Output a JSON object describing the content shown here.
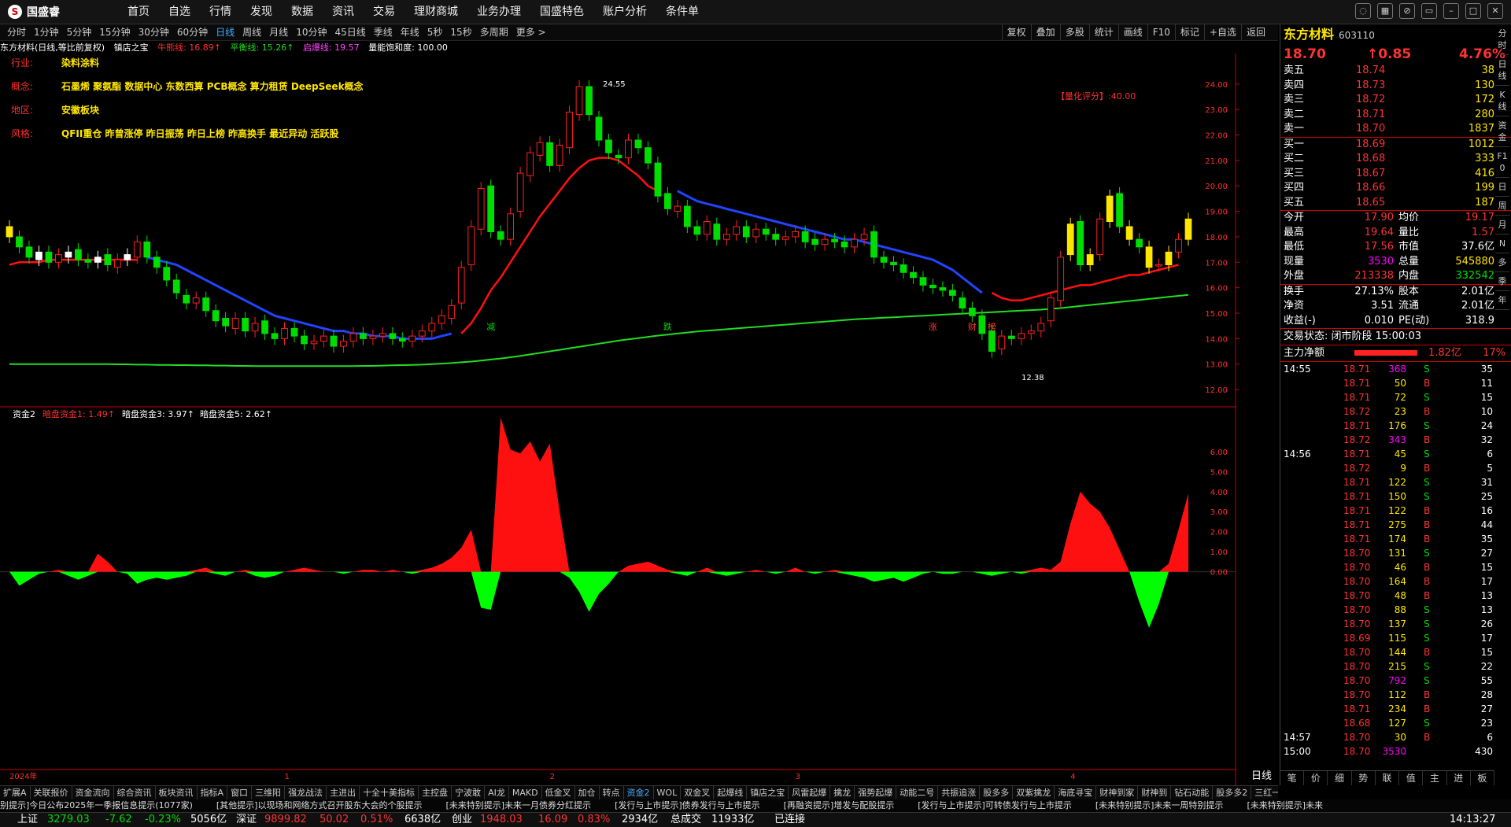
{
  "app": {
    "logo": "国盛睿"
  },
  "menu": [
    "首页",
    "自选",
    "行情",
    "发现",
    "数据",
    "资讯",
    "交易",
    "理财商城",
    "业务办理",
    "国盛特色",
    "账户分析",
    "条件单"
  ],
  "window_controls": [
    "chat-icon",
    "grid-icon",
    "hide-icon",
    "restore-icon",
    "minimize-icon",
    "maximize-icon",
    "close-icon"
  ],
  "periods": [
    "分时",
    "1分钟",
    "5分钟",
    "15分钟",
    "30分钟",
    "60分钟",
    "日线",
    "周线",
    "月线",
    "10分钟",
    "45日线",
    "季线",
    "年线",
    "5秒",
    "15秒",
    "多周期",
    "更多 >"
  ],
  "active_period": "日线",
  "tools": [
    "复权",
    "叠加",
    "多股",
    "统计",
    "画线",
    "F10",
    "标记",
    "+自选",
    "返回"
  ],
  "info": {
    "title": "东方材料(日线,等比前复权)",
    "indicator": "镇店之宝",
    "l1": "牛熊线: 16.89↑",
    "l2": "平衡线: 15.26↑",
    "l3": "启爆线: 19.57",
    "l4": "量能饱和度: 100.00"
  },
  "annotations": {
    "industry_label": "行业:",
    "industry": "染料涂料",
    "concept_label": "概念:",
    "concept": "石墨烯 聚氨酯 数据中心 东数西算 PCB概念 算力租赁 DeepSeek概念",
    "region_label": "地区:",
    "region": "安徽板块",
    "style_label": "风格:",
    "style": "QFII重仓 昨曾涨停 昨日振荡 昨日上榜 昨高换手 最近异动 活跃股",
    "rating": "【量化评分】:40.00",
    "high_label": "24.55",
    "low_label": "12.38"
  },
  "chart_data": {
    "type": "candlestick",
    "price_axis": [
      "24.00",
      "23.00",
      "22.00",
      "21.00",
      "20.00",
      "19.00",
      "18.00",
      "17.00",
      "16.00",
      "15.00",
      "14.00",
      "13.00",
      "12.00"
    ],
    "price_range": [
      11.6,
      25.2
    ],
    "x_labels": [
      "2024年",
      "1",
      "2",
      "3",
      "4"
    ],
    "event_markers": [
      "减",
      "跌",
      "涨",
      "财",
      "榜"
    ],
    "sub_title": "资金2",
    "sub_l1": "暗盘资金1: 1.49↑",
    "sub_l2": "暗盘资金3: 3.97↑",
    "sub_l3": "暗盘资金5: 2.62↑",
    "sub_axis": [
      "6.00",
      "5.00",
      "4.00",
      "3.00",
      "2.00",
      "1.00",
      "0.00"
    ],
    "sub_range": [
      -3.0,
      7.8
    ],
    "closes": [
      18.0,
      17.6,
      17.2,
      17.4,
      17.0,
      17.3,
      17.4,
      17.1,
      17.0,
      17.2,
      16.9,
      17.1,
      17.3,
      17.8,
      17.2,
      16.8,
      16.3,
      15.8,
      15.4,
      15.6,
      15.1,
      14.7,
      14.5,
      14.8,
      14.3,
      14.6,
      14.2,
      14.0,
      14.4,
      14.1,
      13.8,
      13.9,
      14.1,
      13.7,
      13.9,
      14.2,
      14.0,
      14.1,
      14.2,
      14.0,
      13.9,
      14.1,
      14.3,
      14.6,
      14.9,
      15.3,
      16.8,
      18.4,
      19.9,
      18.2,
      17.9,
      18.9,
      20.5,
      21.3,
      21.7,
      20.8,
      21.6,
      22.9,
      23.9,
      22.8,
      21.8,
      21.3,
      21.1,
      21.8,
      21.5,
      20.9,
      19.6,
      19.1,
      19.2,
      18.4,
      18.1,
      18.6,
      17.9,
      18.1,
      18.4,
      18.0,
      18.3,
      18.1,
      17.9,
      18.0,
      18.2,
      17.8,
      17.7,
      17.9,
      17.8,
      17.6,
      17.9,
      18.1,
      17.2,
      17.0,
      16.9,
      16.6,
      16.4,
      16.1,
      16.0,
      15.9,
      15.7,
      15.2,
      14.9,
      14.2,
      13.5,
      14.1,
      14.0,
      14.2,
      14.3,
      14.6,
      15.6,
      17.2,
      18.5,
      16.9,
      17.3,
      18.7,
      19.6,
      18.4,
      17.9,
      17.6,
      16.8,
      16.9,
      17.4,
      17.9,
      18.7
    ],
    "opens": [
      18.4,
      18.0,
      17.6,
      17.1,
      17.4,
      17.0,
      17.2,
      17.5,
      17.1,
      17.0,
      17.3,
      16.8,
      17.1,
      17.2,
      17.8,
      17.2,
      16.8,
      16.3,
      15.7,
      15.4,
      15.6,
      15.1,
      14.8,
      14.4,
      14.8,
      14.3,
      14.7,
      14.2,
      14.0,
      14.4,
      14.1,
      13.8,
      13.9,
      14.1,
      13.7,
      13.9,
      14.2,
      14.0,
      14.1,
      14.2,
      14.0,
      13.9,
      14.1,
      14.3,
      14.6,
      14.8,
      15.4,
      16.9,
      18.3,
      20.0,
      18.2,
      17.9,
      19.0,
      20.4,
      21.2,
      21.7,
      20.8,
      21.5,
      22.8,
      23.9,
      22.7,
      21.8,
      21.2,
      21.1,
      21.8,
      21.5,
      20.9,
      19.7,
      19.0,
      19.2,
      18.4,
      18.1,
      18.5,
      17.9,
      18.1,
      18.4,
      18.0,
      18.3,
      18.1,
      17.9,
      18.0,
      18.2,
      17.9,
      17.7,
      17.9,
      17.8,
      17.6,
      17.9,
      18.2,
      17.2,
      17.0,
      16.9,
      16.6,
      16.4,
      16.1,
      16.0,
      15.9,
      15.6,
      15.2,
      14.9,
      14.3,
      13.6,
      14.1,
      14.0,
      14.2,
      14.3,
      14.7,
      15.5,
      17.3,
      18.6,
      16.9,
      17.3,
      18.6,
      19.7,
      18.4,
      17.9,
      17.6,
      16.9,
      16.9,
      17.4,
      17.9
    ],
    "ma_blue": [
      null,
      null,
      null,
      null,
      null,
      null,
      null,
      null,
      null,
      null,
      null,
      null,
      null,
      null,
      17.2,
      17.1,
      17.0,
      16.9,
      16.7,
      16.5,
      16.3,
      16.1,
      15.9,
      15.7,
      15.5,
      15.3,
      15.1,
      14.9,
      14.8,
      14.7,
      14.6,
      14.5,
      14.4,
      14.3,
      14.3,
      14.2,
      14.2,
      14.1,
      14.1,
      14.1,
      14.0,
      14.0,
      14.0,
      14.0,
      14.1,
      14.2,
      null,
      null,
      null,
      null,
      null,
      null,
      null,
      null,
      null,
      null,
      null,
      null,
      null,
      null,
      null,
      null,
      null,
      null,
      null,
      null,
      null,
      null,
      19.8,
      19.6,
      19.4,
      19.3,
      19.2,
      19.1,
      19.0,
      18.9,
      18.8,
      18.7,
      18.6,
      18.5,
      18.4,
      18.3,
      18.2,
      18.1,
      18.0,
      17.9,
      17.9,
      17.8,
      17.7,
      17.6,
      17.5,
      17.4,
      17.3,
      17.2,
      17.1,
      16.9,
      16.7,
      16.4,
      16.1,
      15.8,
      null,
      null,
      null,
      null,
      null,
      null,
      null,
      null,
      null,
      null,
      null,
      null,
      null,
      null,
      null,
      null,
      null,
      null,
      null,
      null
    ],
    "ma_red": [
      16.9,
      17.0,
      17.0,
      17.0,
      17.1,
      17.1,
      17.1,
      17.1,
      17.1,
      17.1,
      17.1,
      17.1,
      17.1,
      17.1,
      null,
      null,
      null,
      null,
      null,
      null,
      null,
      null,
      null,
      null,
      null,
      null,
      null,
      null,
      null,
      null,
      null,
      null,
      null,
      null,
      null,
      null,
      null,
      null,
      null,
      null,
      null,
      null,
      null,
      null,
      null,
      null,
      14.2,
      14.6,
      15.2,
      15.9,
      16.4,
      17.0,
      17.6,
      18.2,
      18.8,
      19.3,
      19.8,
      20.3,
      20.7,
      21.0,
      21.1,
      21.1,
      21.0,
      20.7,
      20.4,
      20.0,
      19.8,
      null,
      null,
      null,
      null,
      null,
      null,
      null,
      null,
      null,
      null,
      null,
      null,
      null,
      null,
      null,
      null,
      null,
      null,
      null,
      null,
      null,
      null,
      null,
      null,
      null,
      null,
      null,
      null,
      null,
      null,
      null,
      null,
      null,
      15.8,
      15.6,
      15.5,
      15.5,
      15.6,
      15.7,
      15.8,
      15.9,
      16.0,
      16.1,
      16.1,
      16.2,
      16.3,
      16.4,
      16.5,
      16.5,
      16.6,
      16.7,
      16.8,
      16.9
    ],
    "ma_green": [
      13.0,
      13.0,
      13.0,
      13.0,
      13.0,
      13.0,
      13.0,
      13.0,
      13.0,
      13.0,
      13.0,
      12.99,
      12.99,
      12.98,
      12.98,
      12.97,
      12.97,
      12.96,
      12.96,
      12.95,
      12.95,
      12.94,
      12.94,
      12.93,
      12.93,
      12.92,
      12.92,
      12.92,
      12.92,
      12.92,
      12.92,
      12.92,
      12.92,
      12.92,
      12.92,
      12.92,
      12.93,
      12.93,
      12.94,
      12.95,
      12.96,
      12.97,
      12.98,
      13.0,
      13.02,
      13.04,
      13.07,
      13.1,
      13.14,
      13.18,
      13.22,
      13.27,
      13.32,
      13.38,
      13.44,
      13.5,
      13.56,
      13.62,
      13.68,
      13.74,
      13.8,
      13.86,
      13.92,
      13.97,
      14.02,
      14.07,
      14.12,
      14.16,
      14.2,
      14.24,
      14.28,
      14.31,
      14.34,
      14.37,
      14.4,
      14.43,
      14.46,
      14.49,
      14.52,
      14.55,
      14.58,
      14.61,
      14.64,
      14.67,
      14.7,
      14.73,
      14.76,
      14.78,
      14.8,
      14.82,
      14.84,
      14.86,
      14.88,
      14.9,
      14.92,
      14.94,
      14.96,
      14.98,
      15.0,
      15.02,
      15.04,
      15.06,
      15.08,
      15.1,
      15.12,
      15.14,
      15.17,
      15.2,
      15.24,
      15.28,
      15.32,
      15.36,
      15.4,
      15.44,
      15.48,
      15.52,
      15.56,
      15.6,
      15.64,
      15.68,
      15.72
    ],
    "fund_values": [
      0.0,
      -0.7,
      -0.4,
      -0.1,
      0.0,
      0.1,
      -0.2,
      -0.4,
      -0.2,
      0.9,
      0.5,
      0.0,
      -0.1,
      -0.6,
      -0.4,
      -0.3,
      -0.4,
      -0.3,
      -0.2,
      0.1,
      0.2,
      -0.1,
      -0.2,
      0.0,
      0.1,
      -0.2,
      -0.3,
      -0.2,
      0.0,
      0.1,
      0.2,
      0.1,
      0.0,
      0.0,
      -0.1,
      0.0,
      0.1,
      0.1,
      0.0,
      0.1,
      0.0,
      -0.1,
      0.1,
      0.2,
      0.4,
      0.7,
      1.2,
      2.1,
      -1.8,
      -1.9,
      7.7,
      6.1,
      5.9,
      6.5,
      5.5,
      6.4,
      3.0,
      -0.3,
      -1.0,
      -2.0,
      -1.1,
      -0.6,
      0.0,
      0.3,
      0.4,
      0.5,
      0.3,
      0.1,
      -0.1,
      -0.2,
      0.0,
      0.2,
      -0.1,
      -0.2,
      -0.1,
      0.0,
      0.1,
      0.0,
      -0.1,
      0.0,
      0.2,
      0.0,
      -0.1,
      0.0,
      0.1,
      -0.1,
      -0.2,
      -0.3,
      -0.5,
      -0.4,
      -0.3,
      -0.5,
      -0.3,
      -0.1,
      0.0,
      -0.1,
      -0.1,
      0.0,
      0.0,
      -0.1,
      -0.2,
      -0.1,
      0.0,
      -0.1,
      0.1,
      0.2,
      0.1,
      0.5,
      2.4,
      4.0,
      3.4,
      3.0,
      2.2,
      1.1,
      0.0,
      -1.5,
      -2.8,
      -1.6,
      0.4,
      2.1,
      3.9
    ]
  },
  "right_panel": {
    "name": "东方材料",
    "code": "603110",
    "price": "18.70",
    "change": "↑0.85",
    "pct": "4.76%",
    "asks": [
      {
        "label": "卖五",
        "price": "18.74",
        "vol": "38"
      },
      {
        "label": "卖四",
        "price": "18.73",
        "vol": "130"
      },
      {
        "label": "卖三",
        "price": "18.72",
        "vol": "172"
      },
      {
        "label": "卖二",
        "price": "18.71",
        "vol": "280"
      },
      {
        "label": "卖一",
        "price": "18.70",
        "vol": "1837"
      }
    ],
    "bids": [
      {
        "label": "买一",
        "price": "18.69",
        "vol": "1012"
      },
      {
        "label": "买二",
        "price": "18.68",
        "vol": "333"
      },
      {
        "label": "买三",
        "price": "18.67",
        "vol": "416"
      },
      {
        "label": "买四",
        "price": "18.66",
        "vol": "199"
      },
      {
        "label": "买五",
        "price": "18.65",
        "vol": "187"
      }
    ],
    "stats": [
      {
        "l1": "今开",
        "v1": "17.90",
        "l2": "均价",
        "v2": "19.17"
      },
      {
        "l1": "最高",
        "v1": "19.64",
        "l2": "量比",
        "v2": "1.57"
      },
      {
        "l1": "最低",
        "v1": "17.56",
        "l2": "市值",
        "v2": "37.6亿"
      },
      {
        "l1": "现量",
        "v1": "3530",
        "l2": "总量",
        "v2": "545880"
      },
      {
        "l1": "外盘",
        "v1": "213338",
        "l2": "内盘",
        "v2": "332542"
      }
    ],
    "stats2": [
      {
        "l1": "换手",
        "v1": "27.13%",
        "l2": "股本",
        "v2": "2.01亿"
      },
      {
        "l1": "净资",
        "v1": "3.51",
        "l2": "流通",
        "v2": "2.01亿"
      },
      {
        "l1": "收益(-)",
        "v1": "0.010",
        "l2": "PE(动)",
        "v2": "318.9"
      }
    ],
    "trade_state": "交易状态: 闭市阶段 15:00:03",
    "net_label": "主力净额",
    "net_value": "1.82亿",
    "net_pct": "17%",
    "ticks": [
      {
        "t": "14:55",
        "p": "18.71",
        "v": "368",
        "s": "S",
        "n": "35"
      },
      {
        "t": "",
        "p": "18.71",
        "v": "50",
        "s": "B",
        "n": "11"
      },
      {
        "t": "",
        "p": "18.71",
        "v": "72",
        "s": "S",
        "n": "15"
      },
      {
        "t": "",
        "p": "18.72",
        "v": "23",
        "s": "B",
        "n": "10"
      },
      {
        "t": "",
        "p": "18.71",
        "v": "176",
        "s": "S",
        "n": "24"
      },
      {
        "t": "",
        "p": "18.72",
        "v": "343",
        "s": "B",
        "n": "32"
      },
      {
        "t": "14:56",
        "p": "18.71",
        "v": "45",
        "s": "S",
        "n": "6"
      },
      {
        "t": "",
        "p": "18.72",
        "v": "9",
        "s": "B",
        "n": "5"
      },
      {
        "t": "",
        "p": "18.71",
        "v": "122",
        "s": "S",
        "n": "31"
      },
      {
        "t": "",
        "p": "18.71",
        "v": "150",
        "s": "S",
        "n": "25"
      },
      {
        "t": "",
        "p": "18.71",
        "v": "122",
        "s": "B",
        "n": "16"
      },
      {
        "t": "",
        "p": "18.71",
        "v": "275",
        "s": "B",
        "n": "44"
      },
      {
        "t": "",
        "p": "18.71",
        "v": "174",
        "s": "B",
        "n": "35"
      },
      {
        "t": "",
        "p": "18.70",
        "v": "131",
        "s": "S",
        "n": "27"
      },
      {
        "t": "",
        "p": "18.70",
        "v": "46",
        "s": "B",
        "n": "15"
      },
      {
        "t": "",
        "p": "18.70",
        "v": "164",
        "s": "B",
        "n": "17"
      },
      {
        "t": "",
        "p": "18.70",
        "v": "48",
        "s": "B",
        "n": "13"
      },
      {
        "t": "",
        "p": "18.70",
        "v": "88",
        "s": "S",
        "n": "13"
      },
      {
        "t": "",
        "p": "18.70",
        "v": "137",
        "s": "S",
        "n": "26"
      },
      {
        "t": "",
        "p": "18.69",
        "v": "115",
        "s": "S",
        "n": "17"
      },
      {
        "t": "",
        "p": "18.70",
        "v": "144",
        "s": "B",
        "n": "15"
      },
      {
        "t": "",
        "p": "18.70",
        "v": "215",
        "s": "S",
        "n": "22"
      },
      {
        "t": "",
        "p": "18.70",
        "v": "792",
        "s": "S",
        "n": "55"
      },
      {
        "t": "",
        "p": "18.70",
        "v": "112",
        "s": "B",
        "n": "28"
      },
      {
        "t": "",
        "p": "18.71",
        "v": "234",
        "s": "B",
        "n": "27"
      },
      {
        "t": "",
        "p": "18.68",
        "v": "127",
        "s": "S",
        "n": "23"
      },
      {
        "t": "14:57",
        "p": "18.70",
        "v": "30",
        "s": "B",
        "n": "6"
      },
      {
        "t": "15:00",
        "p": "18.70",
        "v": "3530",
        "s": "",
        "n": "430"
      }
    ],
    "bottom_tabs": [
      "笔",
      "价",
      "细",
      "势",
      "联",
      "值",
      "主",
      "进",
      "板"
    ]
  },
  "side_tabs": [
    "分时",
    "日线",
    "K线",
    "资金",
    "F10",
    "日",
    "周",
    "月",
    "N",
    "多",
    "季",
    "年"
  ],
  "bottom_tabs": [
    "扩展A",
    "关联报价",
    "资金流向",
    "综合资讯",
    "板块资讯",
    "指标A",
    "窗口",
    "三维阳",
    "强龙战法",
    "主进出",
    "十全十美指标",
    "主控盘",
    "宁波敢",
    "AI龙",
    "MAKD",
    "低金叉",
    "加仓",
    "转点",
    "资金2",
    "WOL",
    "双金叉",
    "起爆线",
    "镇店之宝",
    "风雷起爆",
    "擒龙",
    "强势起爆",
    "动能二号",
    "共振追涨",
    "股多多",
    "双紫擒龙",
    "海底寻宝",
    "财神到家",
    "财神到",
    "钻石动能",
    "股多多2",
    "三红一紫"
  ],
  "active_bottom_tab": "资金2",
  "bottom_right": [
    "指标B",
    "模板",
    "图文F10",
    "侧边栏"
  ],
  "period_corner": "日线",
  "news": [
    "别提示]今日公布2025年一季报信息提示(1077家)",
    "[其他提示]以现场和网络方式召开股东大会的个股提示",
    "[未来特别提示]未来一月债券分红提示",
    "[发行与上市提示]债券发行与上市提示",
    "[再融资提示]增发与配股提示",
    "[发行与上市提示]可转债发行与上市提示",
    "[未来特别提示]未来一周特别提示",
    "[未来特别提示]未来"
  ],
  "status": {
    "sh_label": "上证",
    "sh": "3279.03",
    "sh_chg": "-7.62",
    "sh_pct": "-0.23%",
    "sh_amt": "5056亿",
    "sz_label": "深证",
    "sz": "9899.82",
    "sz_chg": "50.02",
    "sz_pct": "0.51%",
    "sz_amt": "6638亿",
    "cy_label": "创业",
    "cy": "1948.03",
    "cy_chg": "16.09",
    "cy_pct": "0.83%",
    "cy_amt": "2934亿",
    "total_label": "总成交",
    "total": "11933亿",
    "conn": "已连接",
    "time": "14:13:27"
  },
  "colors": {
    "up": "#ff2020",
    "down": "#00dd00",
    "ma_blue": "#2244ff",
    "ma_red": "#ff1010",
    "ma_green": "#22dd22",
    "yellow": "#ffe600",
    "cyan": "#00e0e0",
    "magenta": "#ff44ff"
  }
}
